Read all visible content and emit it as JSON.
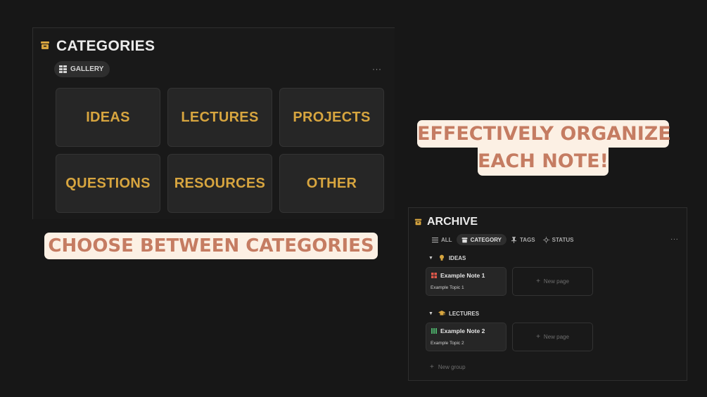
{
  "categories_panel": {
    "title": "CATEGORIES",
    "title_icon": "archive-box-icon",
    "view_label": "GALLERY",
    "view_icon": "gallery-grid-icon",
    "more_label": "···",
    "cards": [
      "IDEAS",
      "LECTURES",
      "PROJECTS",
      "QUESTIONS",
      "RESOURCES",
      "OTHER"
    ]
  },
  "captions": {
    "left": "CHOOSE BETWEEN CATEGORIES",
    "right_line1": "EFFECTIVELY ORGANIZE",
    "right_line2": "EACH NOTE!"
  },
  "archive_panel": {
    "title": "ARCHIVE",
    "title_icon": "archive-box-icon",
    "tabs": [
      {
        "label": "ALL",
        "icon": "list-icon"
      },
      {
        "label": "CATEGORY",
        "icon": "archive-box-icon",
        "active": true
      },
      {
        "label": "TAGS",
        "icon": "pin-icon"
      },
      {
        "label": "STATUS",
        "icon": "sun-icon"
      }
    ],
    "more_label": "···",
    "groups": [
      {
        "arrow": "▼",
        "label": "IDEAS",
        "icon": "lightbulb-icon",
        "note": {
          "name": "Example Note 1",
          "topic": "Example Topic 1",
          "icon": "grid-icon"
        },
        "new_page": "New page"
      },
      {
        "arrow": "▼",
        "label": "LECTURES",
        "icon": "graduation-cap-icon",
        "note": {
          "name": "Example Note 2",
          "topic": "Example Topic 2",
          "icon": "columns-icon"
        },
        "new_page": "New page"
      }
    ],
    "new_group": "New group",
    "plus": "+"
  },
  "colors": {
    "background": "#171717",
    "card": "#262626",
    "category_text": "#d7a53f",
    "caption_bg": "#fcf0e4",
    "caption_text": "#c57c62"
  }
}
